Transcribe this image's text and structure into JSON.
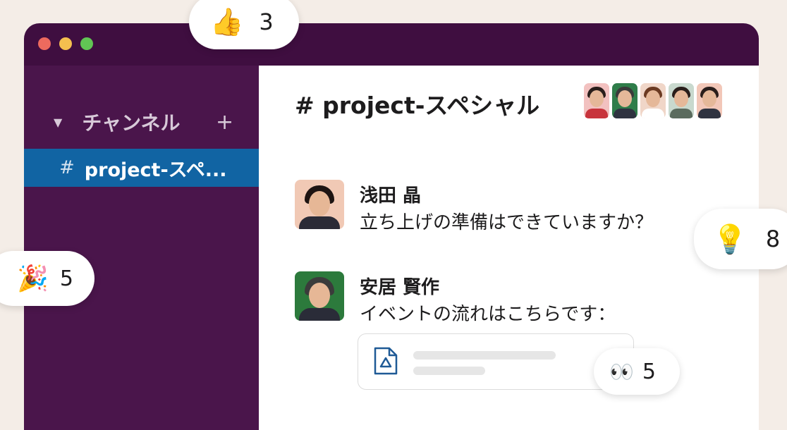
{
  "sidebar": {
    "section_label": "チャンネル",
    "add_label": "+",
    "caret": "▼",
    "active_channel": {
      "hash": "#",
      "name": "project-スペ..."
    }
  },
  "channel": {
    "title": "# project-スペシャル",
    "member_count_shown": 5
  },
  "messages": [
    {
      "author": "浅田 晶",
      "text": "立ち上げの準備はできていますか？"
    },
    {
      "author": "安居 賢作",
      "text": "イベントの流れはこちらです：",
      "attachment_icon": "google-drive-file-icon"
    }
  ],
  "reactions": {
    "thumbs_up": {
      "emoji": "👍",
      "count": "3"
    },
    "lightbulb": {
      "emoji": "💡",
      "count": "8"
    },
    "party": {
      "emoji": "🎉",
      "count": "5"
    },
    "eyes": {
      "emoji": "👀",
      "count": "5"
    }
  },
  "colors": {
    "titlebar": "#3f0e40",
    "sidebar": "#4a154b",
    "active_channel": "#1164a3",
    "background": "#f4ede7"
  }
}
